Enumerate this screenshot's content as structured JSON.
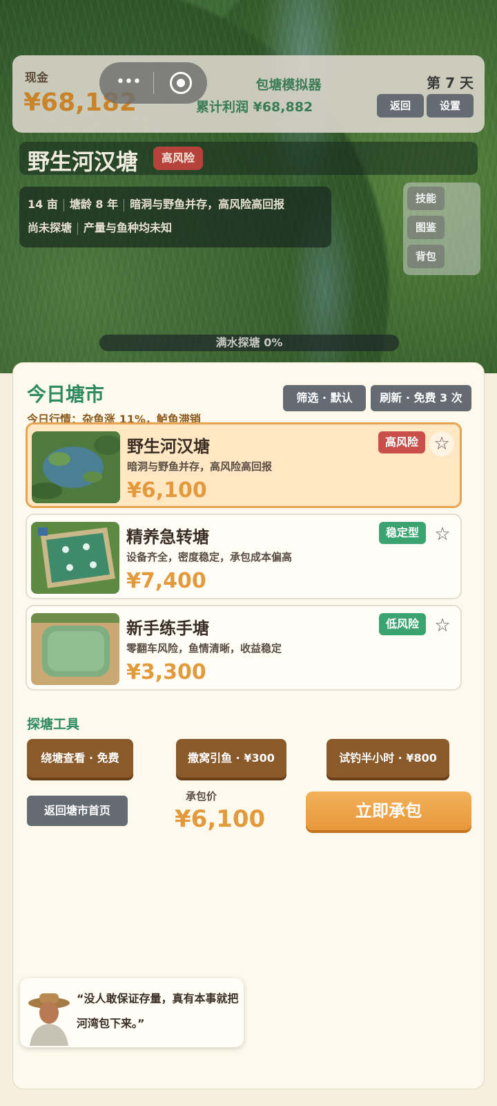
{
  "hud": {
    "cash_label": "现金",
    "cash_value": "¥68,182",
    "game_title": "包塘模拟器",
    "profit": "累计利润 ¥68,882",
    "day": "第 7 天",
    "back_label": "返回",
    "settings_label": "设置",
    "capsule_icons": [
      "more-dots-icon",
      "record-icon"
    ]
  },
  "pond": {
    "name": "野生河汉塘",
    "risk": "高风险",
    "info_line1": [
      "14 亩",
      "塘龄 8 年",
      "暗洞与野鱼并存，高风险高回报"
    ],
    "info_line2": [
      "尚未探塘",
      "产量与鱼种均未知"
    ]
  },
  "side_menu": [
    "技能",
    "图鉴",
    "背包"
  ],
  "progress": {
    "label": "满水探塘  0%",
    "value": 0
  },
  "market": {
    "title": "今日塘市",
    "subtitle": "今日行情：杂鱼涨 11%，鲈鱼滞销",
    "filter_label": "筛选 · 默认",
    "refresh_label": "刷新 · 免费 3 次",
    "cards": [
      {
        "name": "野生河汉塘",
        "desc": "暗洞与野鱼并存，高风险高回报",
        "price": "¥6,100",
        "tag": "高风险",
        "tag_color": "#c9504a",
        "selected": true
      },
      {
        "name": "精养急转塘",
        "desc": "设备齐全，密度稳定，承包成本偏高",
        "price": "¥7,400",
        "tag": "稳定型",
        "tag_color": "#3aa36f",
        "selected": false
      },
      {
        "name": "新手练手塘",
        "desc": "零翻车风险，鱼情清晰，收益稳定",
        "price": "¥3,300",
        "tag": "低风险",
        "tag_color": "#3aa36f",
        "selected": false
      }
    ]
  },
  "tools": {
    "title": "探塘工具",
    "items": [
      "绕塘查看 · 免费",
      "撒窝引鱼 · ¥300",
      "试钓半小时 · ¥800"
    ]
  },
  "footer": {
    "home_label": "返回塘市首页",
    "price_label": "承包价",
    "price_value": "¥6,100",
    "contract_label": "立即承包"
  },
  "quote": {
    "text": "“没人敢保证存量，真有本事就把河湾包下来。”"
  },
  "colors": {
    "accent_green": "#2f8a63",
    "price_orange": "#e29a3c",
    "high_risk": "#c9504a"
  }
}
